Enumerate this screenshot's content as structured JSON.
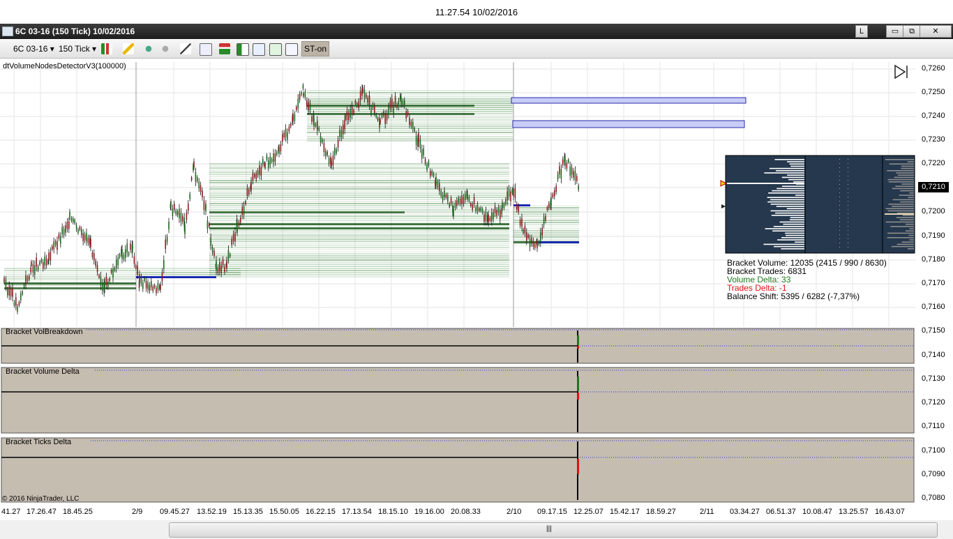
{
  "timestamp": "11.27.54  10/02/2016",
  "window": {
    "title": "6C 03-16 (150 Tick)  10/02/2016",
    "link_button": "L",
    "minimize_label": "▭",
    "restore_label": "⧉",
    "close_label": "✕"
  },
  "toolbar": {
    "instrument": "6C 03-16",
    "interval": "150 Tick",
    "st_on": "ST-on"
  },
  "chart": {
    "indicator_label": "dtVolumeNodesDetectorV3(100000)",
    "current_price": "0,7210",
    "price_labels": [
      "0,7260",
      "0,7250",
      "0,7240",
      "0,7230",
      "0,7220",
      "0,7200",
      "0,7190",
      "0,7180",
      "0,7170",
      "0,7160",
      "0,7150",
      "0,7140",
      "0,7130",
      "0,7120",
      "0,7110",
      "0,7100",
      "0,7090",
      "0,7080"
    ],
    "time_labels": [
      "41.27",
      "17.26.47",
      "18.45.25",
      "2/9",
      "09.45.27",
      "13.52.19",
      "15.13.35",
      "15.50.05",
      "16.22.15",
      "17.13.54",
      "18.15.10",
      "19.16.00",
      "20.08.33",
      "2/10",
      "09.17.15",
      "12.25.07",
      "15.42.17",
      "18.59.27",
      "2/11",
      "03.34.27",
      "06.51.37",
      "10.08.47",
      "13.25.57",
      "16.43.07"
    ],
    "copyright": "© 2016 NinjaTrader, LLC"
  },
  "stats": {
    "bracket_volume": "Bracket Volume: 12035 (2415 / 990 / 8630)",
    "bracket_trades": "Bracket Trades: 6831",
    "volume_delta": "Volume Delta: 33",
    "trades_delta": "Trades Delta: -1",
    "balance_shift": "Balance Shift: 5395 / 6282 (-7,37%)"
  },
  "panels": {
    "vol_breakdown": "Bracket VolBreakdown",
    "volume_delta": "Bracket Volume Delta",
    "ticks_delta": "Bracket Ticks Delta"
  },
  "colors": {
    "panel_bg": "#c6bdb1",
    "green": "#1d6b1d",
    "blue_box": "#c8ccf6",
    "delta_green": "#1a7a1a",
    "delta_red": "#e01010"
  }
}
